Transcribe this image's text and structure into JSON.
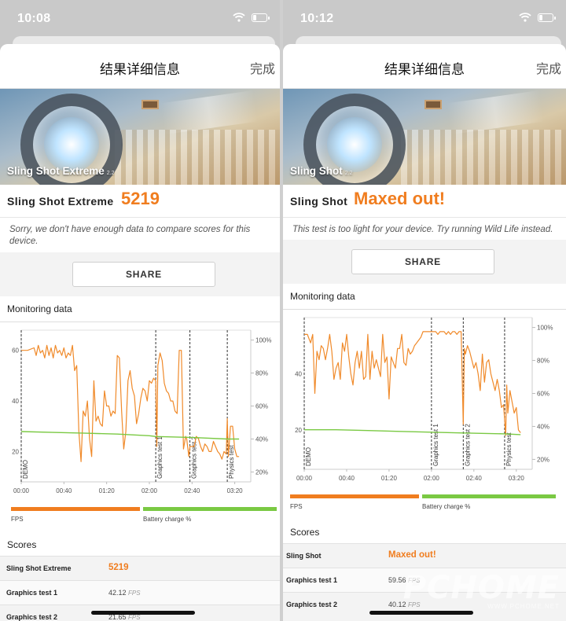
{
  "left": {
    "status_time": "10:08",
    "nav": {
      "title": "结果详细信息",
      "done": "完成"
    },
    "banner": {
      "label": "Sling Shot Extreme",
      "version": "2.2"
    },
    "score": {
      "name": "Sling Shot Extreme",
      "value": "5219"
    },
    "message": "Sorry, we don't have enough data to compare scores for this device.",
    "share_label": "SHARE",
    "monitoring_title": "Monitoring data",
    "legend": {
      "fps": "FPS",
      "battery": "Battery charge %"
    },
    "scores_title": "Scores",
    "scores": [
      {
        "name": "Sling Shot Extreme",
        "value": "5219",
        "unit": ""
      },
      {
        "name": "Graphics test 1",
        "value": "42.12",
        "unit": "FPS"
      },
      {
        "name": "Graphics test 2",
        "value": "21.65",
        "unit": "FPS"
      }
    ]
  },
  "right": {
    "status_time": "10:12",
    "nav": {
      "title": "结果详细信息",
      "done": "完成"
    },
    "banner": {
      "label": "Sling Shot",
      "version": "2.2"
    },
    "score": {
      "name": "Sling Shot",
      "value": "Maxed out!"
    },
    "message": "This test is too light for your device. Try running Wild Life instead.",
    "share_label": "SHARE",
    "monitoring_title": "Monitoring data",
    "legend": {
      "fps": "FPS",
      "battery": "Battery charge %"
    },
    "scores_title": "Scores",
    "scores": [
      {
        "name": "Sling Shot",
        "value": "Maxed out!",
        "unit": ""
      },
      {
        "name": "Graphics test 1",
        "value": "59.56",
        "unit": "FPS"
      },
      {
        "name": "Graphics test 2",
        "value": "40.12",
        "unit": "FPS"
      }
    ]
  },
  "watermark": {
    "logo": "PCHOME",
    "url": "WWW.PCHOME.NET"
  },
  "colors": {
    "accent_orange": "#f07d1f",
    "battery_green": "#7ac943",
    "fps_line": "#f08a2a"
  },
  "chart_data": [
    {
      "type": "line",
      "title": "Monitoring data",
      "x_tick_labels": [
        "00:00",
        "00:40",
        "01:20",
        "02:00",
        "02:40",
        "03:20"
      ],
      "x_ticks_seconds": [
        0,
        40,
        80,
        120,
        160,
        200
      ],
      "xlim_seconds": [
        0,
        215
      ],
      "y_left_ticks": [
        20,
        40,
        60
      ],
      "ylim_left": [
        8,
        68
      ],
      "y_right_ticks": [
        "20%",
        "40%",
        "60%",
        "80%",
        "100%"
      ],
      "ylim_right": [
        14,
        106
      ],
      "phases": [
        {
          "label": "DEMO",
          "start": 0
        },
        {
          "label": "Graphics test 1",
          "start": 126
        },
        {
          "label": "Graphics test 2",
          "start": 158
        },
        {
          "label": "Physics test",
          "start": 193
        }
      ],
      "series": [
        {
          "name": "FPS",
          "axis": "left",
          "x": [
            0,
            6,
            12,
            14,
            16,
            18,
            20,
            22,
            24,
            26,
            28,
            30,
            32,
            34,
            36,
            38,
            40,
            42,
            44,
            46,
            48,
            50,
            52,
            54,
            56,
            58,
            60,
            62,
            64,
            66,
            68,
            70,
            72,
            74,
            76,
            78,
            80,
            82,
            84,
            86,
            88,
            90,
            92,
            94,
            96,
            98,
            100,
            102,
            104,
            106,
            108,
            110,
            112,
            114,
            116,
            118,
            120,
            122,
            124,
            126,
            127,
            128,
            130,
            132,
            134,
            136,
            138,
            140,
            142,
            144,
            146,
            148,
            150,
            152,
            154,
            155,
            157,
            158,
            160,
            162,
            164,
            166,
            168,
            170,
            172,
            174,
            176,
            178,
            180,
            182,
            184,
            186,
            188,
            190,
            192,
            193,
            194,
            196,
            198,
            200,
            202,
            204
          ],
          "y": [
            60,
            60,
            61,
            58,
            62,
            59,
            60,
            57,
            62,
            58,
            61,
            57,
            62,
            59,
            60,
            58,
            61,
            57,
            59,
            58,
            62,
            52,
            54,
            28,
            16,
            36,
            34,
            40,
            25,
            18,
            48,
            32,
            34,
            31,
            30,
            44,
            38,
            38,
            34,
            36,
            35,
            58,
            57,
            36,
            21,
            28,
            48,
            52,
            45,
            42,
            31,
            35,
            41,
            45,
            44,
            40,
            48,
            47,
            49,
            48,
            22,
            54,
            59,
            56,
            47,
            44,
            43,
            40,
            40,
            36,
            35,
            60,
            60,
            21,
            26,
            25,
            18,
            22,
            22,
            22,
            26,
            25,
            22,
            20,
            23,
            22,
            20,
            20,
            24,
            22,
            20,
            19,
            17,
            20,
            19,
            33,
            18,
            30,
            30,
            21,
            18,
            18
          ]
        },
        {
          "name": "Battery charge %",
          "axis": "right",
          "x": [
            0,
            30,
            60,
            90,
            120,
            126,
            158,
            193,
            204
          ],
          "y": [
            44.5,
            44,
            43.5,
            43,
            42,
            41.5,
            41,
            40,
            40
          ]
        }
      ]
    },
    {
      "type": "line",
      "title": "Monitoring data",
      "x_tick_labels": [
        "00:00",
        "00:40",
        "01:20",
        "02:00",
        "02:40",
        "03:20"
      ],
      "x_ticks_seconds": [
        0,
        40,
        80,
        120,
        160,
        200
      ],
      "xlim_seconds": [
        0,
        215
      ],
      "y_left_ticks": [
        20,
        40
      ],
      "ylim_left": [
        6,
        60
      ],
      "y_right_ticks": [
        "20%",
        "40%",
        "60%",
        "80%",
        "100%"
      ],
      "ylim_right": [
        14,
        106
      ],
      "phases": [
        {
          "label": "DEMO",
          "start": 0
        },
        {
          "label": "Graphics test 1",
          "start": 120
        },
        {
          "label": "Graphics test 2",
          "start": 150
        },
        {
          "label": "Physics test",
          "start": 189
        }
      ],
      "series": [
        {
          "name": "FPS",
          "axis": "left",
          "x": [
            0,
            3,
            6,
            8,
            10,
            12,
            14,
            16,
            18,
            20,
            22,
            24,
            26,
            28,
            30,
            32,
            34,
            36,
            38,
            40,
            42,
            44,
            46,
            48,
            50,
            52,
            54,
            56,
            58,
            60,
            62,
            64,
            66,
            68,
            70,
            72,
            74,
            76,
            78,
            80,
            82,
            84,
            86,
            88,
            90,
            92,
            94,
            96,
            98,
            100,
            102,
            104,
            106,
            108,
            110,
            112,
            114,
            116,
            118,
            120,
            122,
            124,
            126,
            128,
            130,
            132,
            134,
            136,
            138,
            140,
            142,
            144,
            146,
            148,
            150,
            151,
            152,
            154,
            156,
            158,
            160,
            162,
            164,
            166,
            168,
            170,
            172,
            174,
            176,
            178,
            180,
            182,
            184,
            186,
            188,
            190,
            191,
            192,
            194,
            196,
            198,
            200,
            202,
            204
          ],
          "y": [
            54,
            54,
            51,
            54,
            33,
            48,
            45,
            50,
            49,
            45,
            49,
            54,
            48,
            38,
            42,
            44,
            38,
            51,
            48,
            54,
            46,
            40,
            36,
            44,
            48,
            42,
            48,
            38,
            39,
            54,
            38,
            48,
            42,
            45,
            42,
            39,
            54,
            44,
            46,
            31,
            46,
            44,
            42,
            49,
            49,
            54,
            44,
            43,
            49,
            47,
            48,
            50,
            51,
            52,
            53,
            55,
            55,
            55,
            55,
            55,
            55,
            55,
            54,
            55,
            55,
            55,
            54,
            55,
            54,
            55,
            55,
            54,
            55,
            55,
            22,
            49,
            47,
            50,
            48,
            45,
            42,
            44,
            40,
            34,
            47,
            37,
            44,
            45,
            40,
            37,
            34,
            38,
            34,
            28,
            29,
            18,
            36,
            26,
            34,
            30,
            26,
            28,
            20,
            19
          ]
        },
        {
          "name": "Battery charge %",
          "axis": "right",
          "x": [
            0,
            30,
            60,
            90,
            120,
            150,
            189,
            204
          ],
          "y": [
            38,
            38,
            37.5,
            37,
            36.5,
            36,
            35.5,
            35
          ]
        }
      ]
    }
  ]
}
